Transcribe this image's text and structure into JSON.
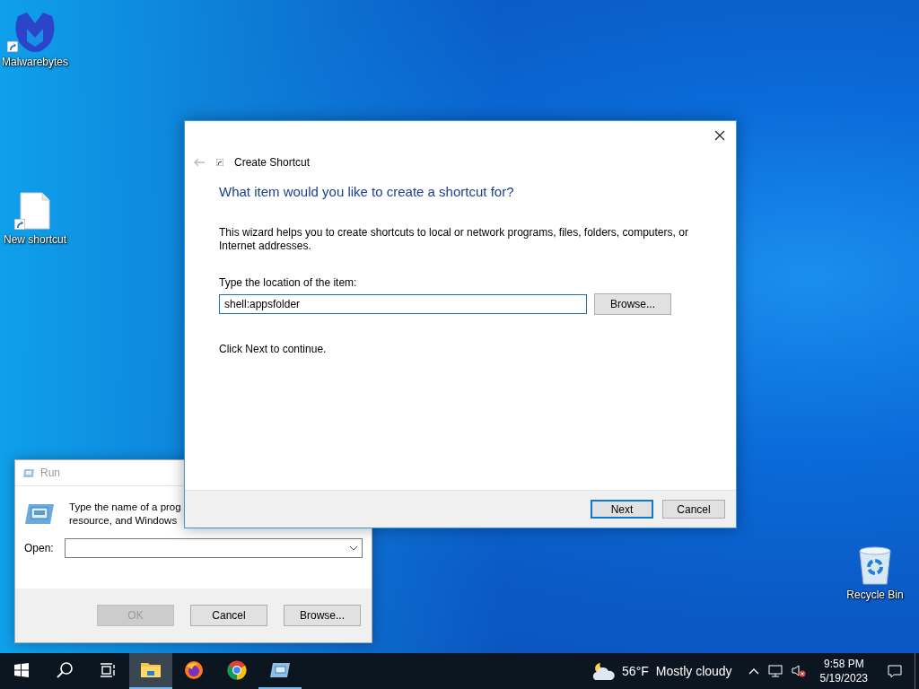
{
  "desktop_icons": [
    {
      "kind": "malwarebytes",
      "label": "Malwarebytes"
    },
    {
      "kind": "document",
      "label": "New shortcut"
    },
    {
      "kind": "recycle",
      "label": "Recycle Bin"
    }
  ],
  "run_dialog": {
    "title": "Run",
    "prompt_lines": [
      "Type the name of a prog",
      "resource, and Windows"
    ],
    "open_label": "Open:",
    "buttons": [
      {
        "label": "OK",
        "disabled": true
      },
      {
        "label": "Cancel",
        "disabled": false
      },
      {
        "label": "Browse...",
        "disabled": false
      }
    ]
  },
  "wizard": {
    "title": "Create Shortcut",
    "heading": "What item would you like to create a shortcut for?",
    "description": "This wizard helps you to create shortcuts to local or network programs, files, folders, computers, or Internet addresses.",
    "field_label": "Type the location of the item:",
    "field_value": "shell:appsfolder",
    "browse_button": "Browse...",
    "hint": "Click Next to continue.",
    "buttons": [
      {
        "label": "Next",
        "default": true
      },
      {
        "label": "Cancel",
        "default": false
      }
    ]
  },
  "taskbar": {
    "apps": [
      {
        "kind": "start",
        "active": false,
        "running": false
      },
      {
        "kind": "search",
        "active": false,
        "running": false
      },
      {
        "kind": "taskview",
        "active": false,
        "running": false
      },
      {
        "kind": "explorer",
        "active": true,
        "running": true
      },
      {
        "kind": "firefox",
        "active": false,
        "running": false
      },
      {
        "kind": "chrome",
        "active": false,
        "running": false
      },
      {
        "kind": "run",
        "active": false,
        "running": true
      }
    ],
    "weather": {
      "temperature": "56°F",
      "condition": "Mostly cloudy"
    },
    "clock": {
      "time": "9:58 PM",
      "date": "5/19/2023"
    }
  }
}
